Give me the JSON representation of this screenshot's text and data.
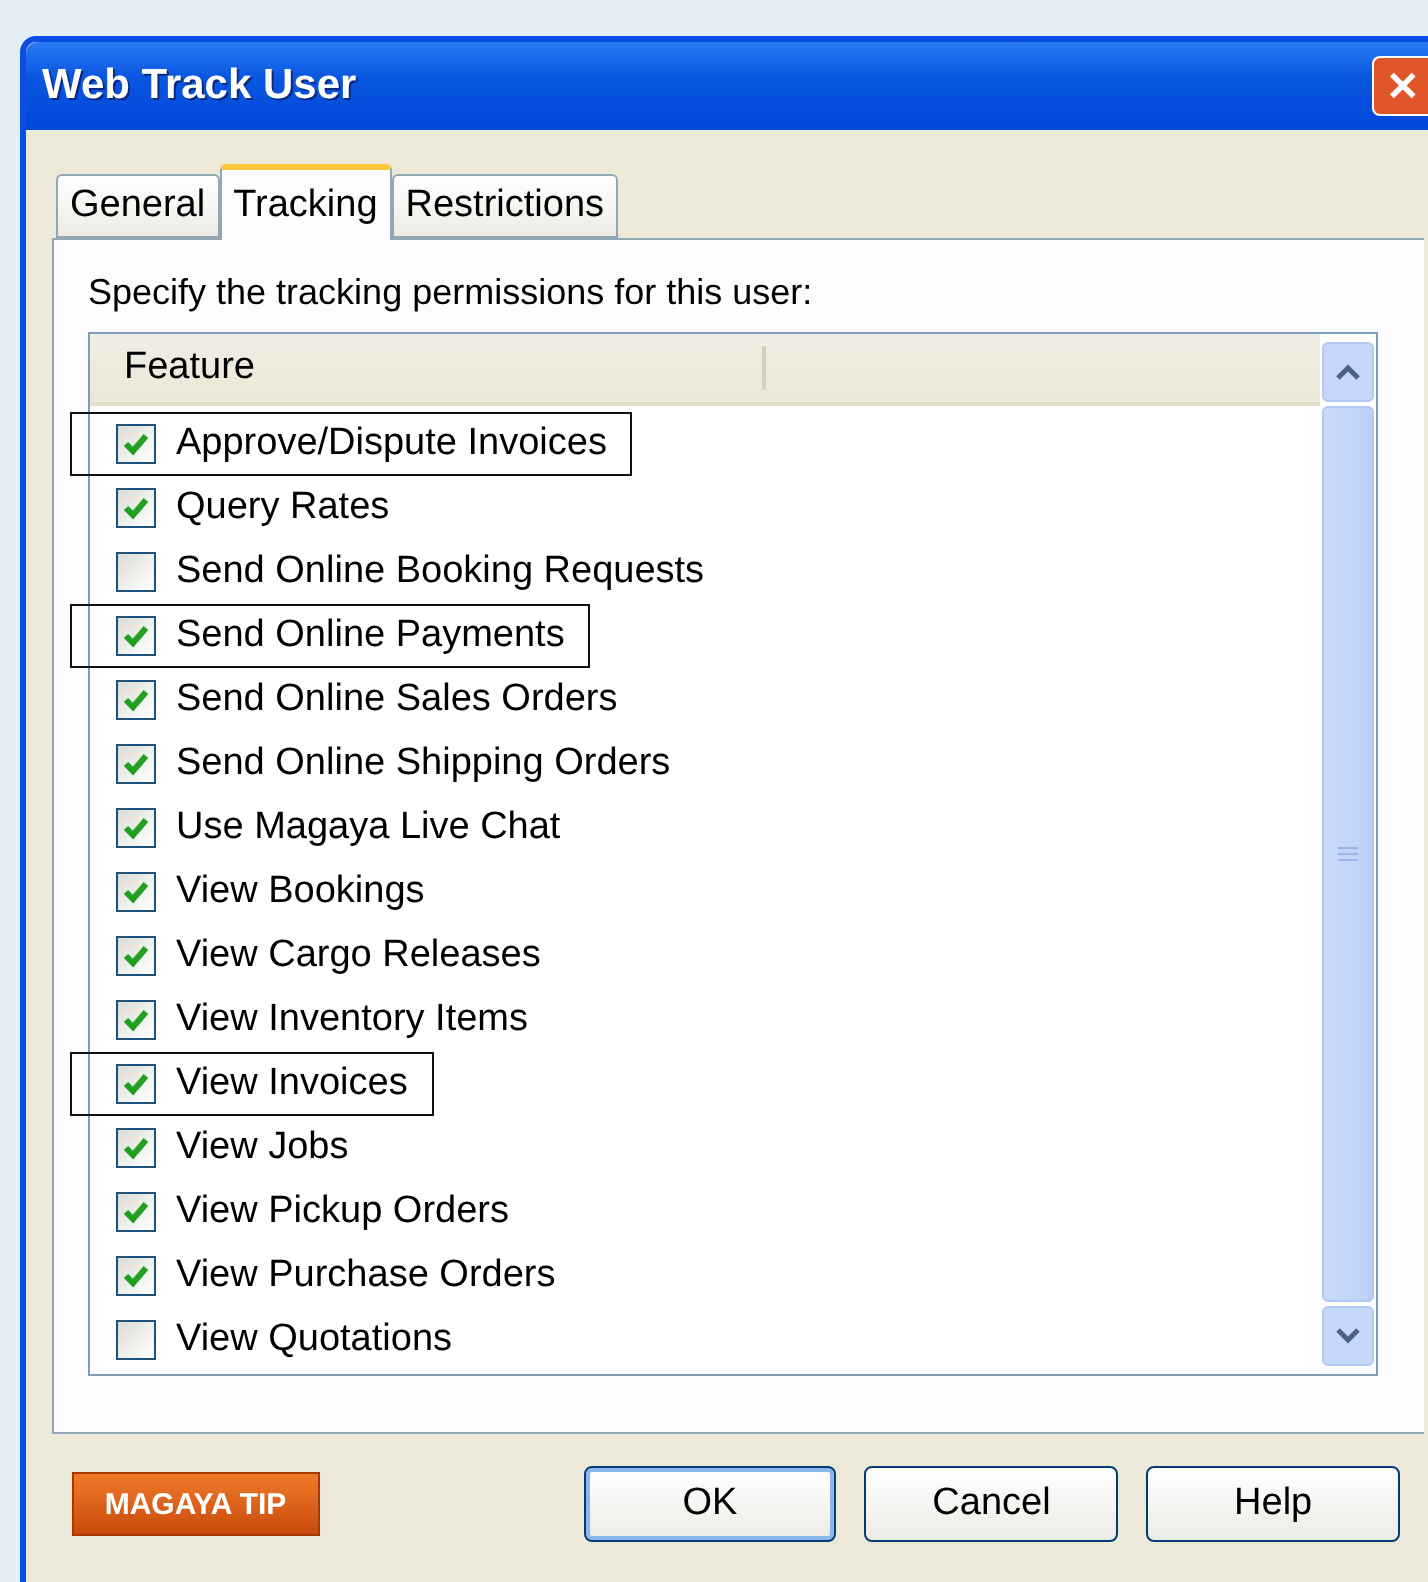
{
  "window": {
    "title": "Web Track User",
    "close": "✕"
  },
  "tabs": [
    {
      "label": "General",
      "selected": false
    },
    {
      "label": "Tracking",
      "selected": true
    },
    {
      "label": "Restrictions",
      "selected": false
    }
  ],
  "instruction": "Specify the tracking permissions for this user:",
  "table": {
    "columns": [
      "Feature"
    ],
    "rows": [
      {
        "label": "Approve/Dispute Invoices",
        "checked": true,
        "marked": true
      },
      {
        "label": "Query Rates",
        "checked": true,
        "marked": false
      },
      {
        "label": "Send Online Booking Requests",
        "checked": false,
        "marked": false
      },
      {
        "label": "Send Online Payments",
        "checked": true,
        "marked": true
      },
      {
        "label": "Send Online Sales Orders",
        "checked": true,
        "marked": false
      },
      {
        "label": "Send Online Shipping Orders",
        "checked": true,
        "marked": false
      },
      {
        "label": "Use Magaya Live Chat",
        "checked": true,
        "marked": false
      },
      {
        "label": "View Bookings",
        "checked": true,
        "marked": false
      },
      {
        "label": "View Cargo Releases",
        "checked": true,
        "marked": false
      },
      {
        "label": "View Inventory Items",
        "checked": true,
        "marked": false
      },
      {
        "label": "View Invoices",
        "checked": true,
        "marked": true
      },
      {
        "label": "View Jobs",
        "checked": true,
        "marked": false
      },
      {
        "label": "View Pickup Orders",
        "checked": true,
        "marked": false
      },
      {
        "label": "View Purchase Orders",
        "checked": true,
        "marked": false
      },
      {
        "label": "View Quotations",
        "checked": false,
        "marked": false
      }
    ]
  },
  "tip": "MAGAYA TIP",
  "buttons": [
    {
      "label": "OK",
      "default": true
    },
    {
      "label": "Cancel",
      "default": false
    },
    {
      "label": "Help",
      "default": false
    }
  ]
}
